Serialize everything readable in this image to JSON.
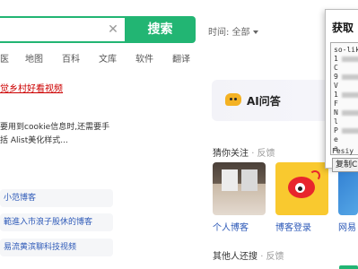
{
  "search": {
    "button_label": "搜索",
    "time_filter": "时间: 全部"
  },
  "tabs": [
    "医",
    "地图",
    "百科",
    "文库",
    "软件",
    "翻译"
  ],
  "results": {
    "link_title": "觉乡村好看视频",
    "snippet_line1": "要用到cookie信息时,还需要手",
    "snippet_line2": "括 Alist美化样式..."
  },
  "related": [
    "小范博客",
    "範進入市浪子股休的博客",
    "易流黄滨聊科技视频"
  ],
  "sidebar": {
    "ai_label": "AI问答",
    "guess_title": "猜你关注",
    "guess_feedback": "· 反馈",
    "thumbs": [
      "个人博客",
      "博客登录",
      "网易"
    ],
    "others_title": "其他人还搜",
    "others_feedback": "· 反馈"
  },
  "popup": {
    "title": "获取",
    "code_lines": [
      "so-lik",
      "1",
      "C",
      "9",
      "V",
      "1",
      "F",
      "N",
      "l",
      "P",
      "e",
      "a",
      "Fesiy"
    ],
    "copy_label": "复制C"
  },
  "colors": {
    "accent": "#22b573",
    "link": "#2e5ab8",
    "visited_link": "#cc0000"
  }
}
